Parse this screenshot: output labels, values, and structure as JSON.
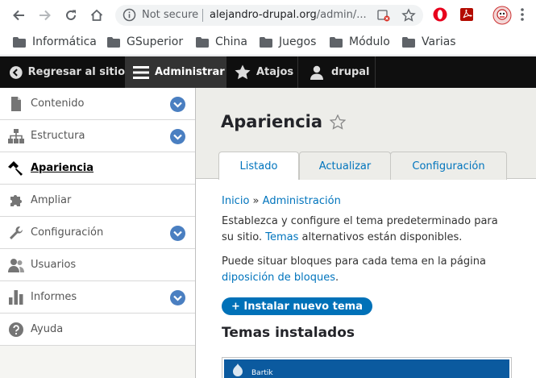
{
  "browser": {
    "security_label": "Not secure",
    "url_host": "alejandro-drupal.org",
    "url_path": "/admin/...",
    "bookmarks": [
      "Informática",
      "GSuperior",
      "China",
      "Juegos",
      "Módulo",
      "Varias"
    ]
  },
  "toolbar": {
    "back_label": "Regresar al sitio",
    "manage_label": "Administrar",
    "shortcuts_label": "Atajos",
    "user_label": "drupal"
  },
  "sidebar": {
    "items": [
      {
        "label": "Contenido",
        "icon": "file-icon"
      },
      {
        "label": "Estructura",
        "icon": "sitemap-icon"
      },
      {
        "label": "Apariencia",
        "icon": "paintbrush-icon"
      },
      {
        "label": "Ampliar",
        "icon": "puzzle-icon"
      },
      {
        "label": "Configuración",
        "icon": "wrench-icon"
      },
      {
        "label": "Usuarios",
        "icon": "people-icon"
      },
      {
        "label": "Informes",
        "icon": "bar-chart-icon"
      },
      {
        "label": "Ayuda",
        "icon": "help-icon"
      }
    ]
  },
  "main": {
    "title": "Apariencia",
    "tabs": [
      "Listado",
      "Actualizar",
      "Configuración"
    ],
    "breadcrumb": {
      "home": "Inicio",
      "separator": "»",
      "admin": "Administración"
    },
    "intro": {
      "before": "Establezca y configure el tema predeterminado para su sitio. ",
      "link": "Temas",
      "after": " alternativos están disponibles."
    },
    "blocks": {
      "before": "Puede situar bloques para cada tema en la página ",
      "link": "diposición de bloques",
      "after": "."
    },
    "install_button": "+ Instalar nuevo tema",
    "installed_title": "Temas instalados",
    "theme_name": "Bartik"
  },
  "colors": {
    "accent": "#0074bd",
    "button": "#0071b8",
    "toolbar": "#0f0f0f"
  }
}
